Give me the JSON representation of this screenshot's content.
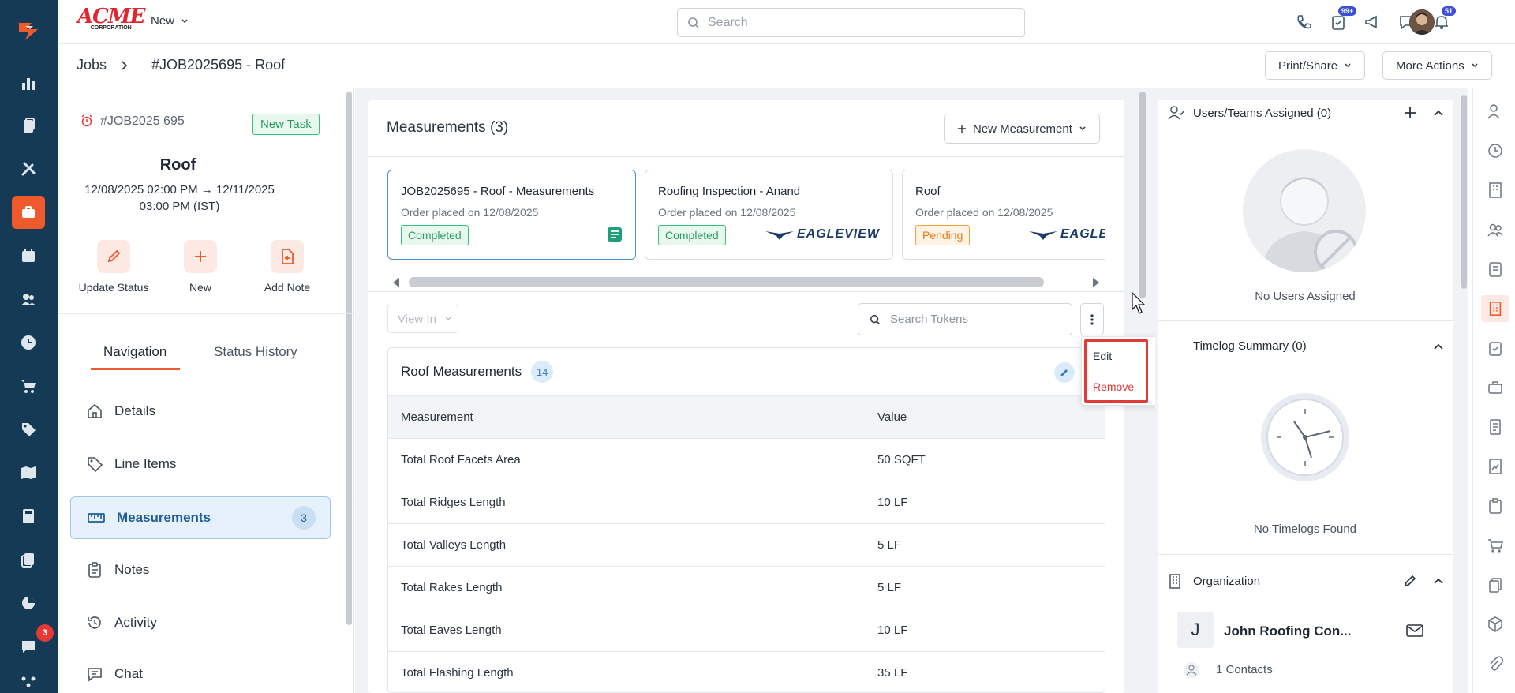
{
  "app": {
    "logo_text": "ACME",
    "logo_sub": "CORPORATION",
    "new_label": "New",
    "search_placeholder": "Search",
    "notif_tasks": "99+",
    "notif_bell": "51",
    "rail_badge": "3"
  },
  "breadcrumb": {
    "root": "Jobs",
    "current": "#JOB2025695 - Roof"
  },
  "header_buttons": {
    "print": "Print/Share",
    "more": "More Actions"
  },
  "job": {
    "id": "#JOB2025 695",
    "tag": "New Task",
    "title": "Roof",
    "dates": "12/08/2025 02:00 PM → 12/11/2025 03:00 PM (IST)",
    "actions": {
      "update": "Update Status",
      "new": "New",
      "note": "Add Note"
    }
  },
  "tabs": {
    "navigation": "Navigation",
    "history": "Status History"
  },
  "nav": {
    "details": "Details",
    "line_items": "Line Items",
    "measurements": "Measurements",
    "measurements_count": "3",
    "notes": "Notes",
    "activity": "Activity",
    "chat": "Chat"
  },
  "main": {
    "title": "Measurements (3)",
    "new_button": "New Measurement",
    "cards": [
      {
        "title": "JOB2025695 - Roof - Measurements",
        "sub": "Order placed on 12/08/2025",
        "status": "Completed"
      },
      {
        "title": "Roofing Inspection - Anand",
        "sub": "Order placed on 12/08/2025",
        "status": "Completed",
        "brand": "EAGLEVIEW"
      },
      {
        "title": "Roof",
        "sub": "Order placed on 12/08/2025",
        "status": "Pending",
        "brand": "EAGLE"
      }
    ],
    "view_in": "View In",
    "token_placeholder": "Search Tokens",
    "menu": {
      "edit": "Edit",
      "remove": "Remove"
    },
    "table_title": "Roof Measurements",
    "table_count": "14",
    "columns": {
      "measurement": "Measurement",
      "value": "Value"
    },
    "rows": [
      {
        "name": "Total Roof Facets Area",
        "value": "50  SQFT"
      },
      {
        "name": "Total Ridges Length",
        "value": "10  LF"
      },
      {
        "name": "Total Valleys Length",
        "value": "5  LF"
      },
      {
        "name": "Total Rakes Length",
        "value": "5  LF"
      },
      {
        "name": "Total Eaves Length",
        "value": "10  LF"
      },
      {
        "name": "Total Flashing Length",
        "value": "35  LF"
      }
    ]
  },
  "right": {
    "users_title": "Users/Teams Assigned (0)",
    "no_users": "No Users Assigned",
    "timelog_title": "Timelog Summary (0)",
    "no_timelogs": "No Timelogs Found",
    "org_title": "Organization",
    "org_initial": "J",
    "org_name": "John Roofing Con...",
    "contacts": "1 Contacts"
  },
  "colors": {
    "rail": "#153a56",
    "accent": "#ee5a2c",
    "danger": "#e53935",
    "success": "#2a9c5e",
    "pending": "#e57a12"
  }
}
